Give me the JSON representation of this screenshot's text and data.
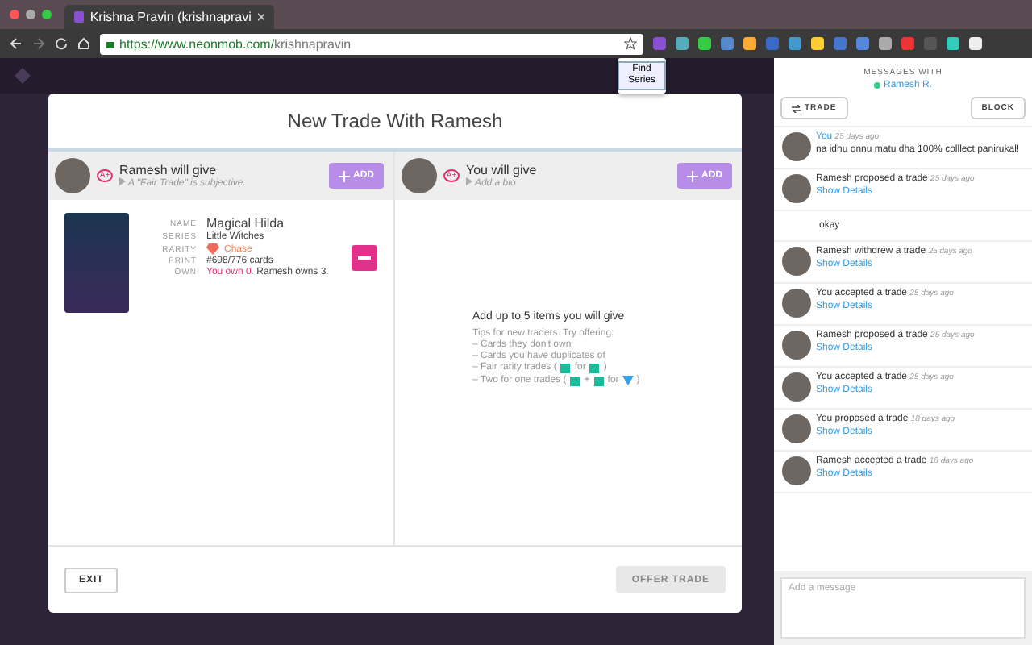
{
  "browser": {
    "tab_title": "Krishna Pravin (krishnapravi",
    "url_host": "https://www.neonmob.com/",
    "url_path": "krishnapravin",
    "popup": "Find Series"
  },
  "modal": {
    "title": "New Trade With Ramesh",
    "sides": [
      {
        "badge": "A+",
        "title": "Ramesh will give",
        "subtitle": "A \"Fair Trade\" is subjective.",
        "add": "ADD"
      },
      {
        "badge": "A+",
        "title": "You will give",
        "subtitle": "Add a bio",
        "add": "ADD"
      }
    ],
    "card": {
      "fields": [
        {
          "label": "NAME",
          "value": "Magical Hilda",
          "kind": "name"
        },
        {
          "label": "SERIES",
          "value": "Little Witches",
          "kind": "plain"
        },
        {
          "label": "RARITY",
          "value": "Chase",
          "kind": "rarity"
        },
        {
          "label": "PRINT",
          "value": "#698/776 cards",
          "kind": "plain"
        },
        {
          "label": "OWN",
          "value": "You own 0.",
          "extra": "Ramesh owns 3.",
          "kind": "own"
        }
      ]
    },
    "empty_title": "Add up to 5 items you will give",
    "tips": [
      [
        {
          "kind": "text",
          "text": "Tips for new traders. Try offering:"
        }
      ],
      [
        {
          "kind": "text",
          "text": "– Cards they don't own"
        }
      ],
      [
        {
          "kind": "text",
          "text": "– Cards you have duplicates of"
        }
      ],
      [
        {
          "kind": "text",
          "text": "– Fair rarity trades ("
        },
        {
          "kind": "common"
        },
        {
          "kind": "text",
          "text": "for"
        },
        {
          "kind": "common"
        },
        {
          "kind": "text",
          "text": ")"
        }
      ],
      [
        {
          "kind": "text",
          "text": "– Two for one trades ("
        },
        {
          "kind": "common"
        },
        {
          "kind": "text",
          "text": "+"
        },
        {
          "kind": "common"
        },
        {
          "kind": "text",
          "text": "for"
        },
        {
          "kind": "rare"
        },
        {
          "kind": "text",
          "text": ")"
        }
      ]
    ],
    "exit": "EXIT",
    "offer": "OFFER TRADE"
  },
  "messages": {
    "heading": "MESSAGES WITH",
    "partner": "Ramesh R.",
    "trade": "TRADE",
    "block": "BLOCK",
    "items": [
      {
        "kind": "message",
        "who": "You",
        "time": "25 days ago",
        "text": "na idhu onnu matu dha 100% colllect panirukal!"
      },
      {
        "kind": "event",
        "who": "Ramesh proposed a trade",
        "time": "25 days ago",
        "link": "Show Details"
      },
      {
        "kind": "text",
        "text": "okay"
      },
      {
        "kind": "event",
        "who": "Ramesh withdrew a trade",
        "time": "25 days ago",
        "link": "Show Details"
      },
      {
        "kind": "event",
        "who": "You accepted a trade",
        "time": "25 days ago",
        "link": "Show Details"
      },
      {
        "kind": "event",
        "who": "Ramesh proposed a trade",
        "time": "25 days ago",
        "link": "Show Details"
      },
      {
        "kind": "event",
        "who": "You accepted a trade",
        "time": "25 days ago",
        "link": "Show Details"
      },
      {
        "kind": "event",
        "who": "You proposed a trade",
        "time": "18 days ago",
        "link": "Show Details"
      },
      {
        "kind": "event",
        "who": "Ramesh accepted a trade",
        "time": "18 days ago",
        "link": "Show Details"
      }
    ],
    "placeholder": "Add a message"
  }
}
